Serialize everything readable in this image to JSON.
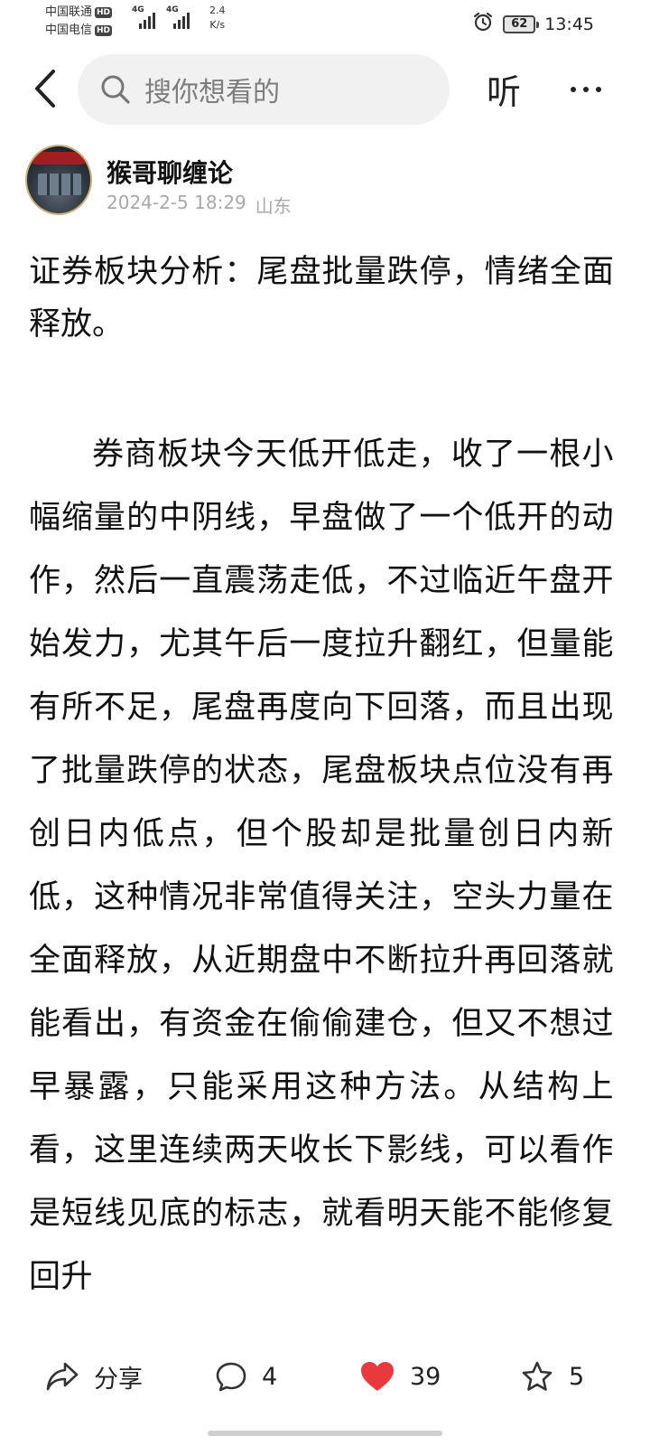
{
  "status_bar": {
    "carrier1": "中国联通",
    "carrier2": "中国电信",
    "hd_label": "HD",
    "network_tech1": "4G",
    "network_tech2": "4G",
    "speed_value": "2.4",
    "speed_unit": "K/s",
    "battery_level": "62",
    "time": "13:45"
  },
  "header": {
    "search_placeholder": "搜你想看的",
    "listen_label": "听"
  },
  "author": {
    "name": "猴哥聊缠论",
    "datetime": "2024-2-5 18:29",
    "location": "山东"
  },
  "article": {
    "title": "证券板块分析：尾盘批量跌停，情绪全面释放。",
    "body": "券商板块今天低开低走，收了一根小幅缩量的中阴线，早盘做了一个低开的动作，然后一直震荡走低，不过临近午盘开始发力，尤其午后一度拉升翻红，但量能有所不足，尾盘再度向下回落，而且出现了批量跌停的状态，尾盘板块点位没有再创日内低点，但个股却是批量创日内新低，这种情况非常值得关注，空头力量在全面释放，从近期盘中不断拉升再回落就能看出，有资金在偷偷建仓，但又不想过早暴露，只能采用这种方法。从结构上看，这里连续两天收长下影线，可以看作是短线见底的标志，就看明天能不能修复回升"
  },
  "actions": {
    "share_label": "分享",
    "comment_count": "4",
    "like_count": "39",
    "favorite_count": "5"
  },
  "colors": {
    "like_red": "#e8393d",
    "meta_gray": "#a8a8a8",
    "search_bg": "#f1f1f1"
  }
}
